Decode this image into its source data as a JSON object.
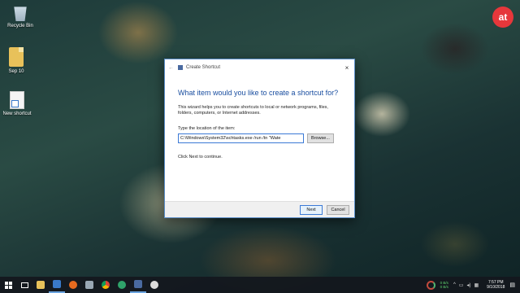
{
  "desktop": {
    "icons": [
      {
        "label": "Recycle Bin",
        "icon": "recycle-bin-icon"
      },
      {
        "label": "Sep 10",
        "icon": "folder-icon"
      },
      {
        "label": "New shortcut",
        "icon": "shortcut-icon"
      }
    ],
    "logo_text": "at"
  },
  "dialog": {
    "title": "Create Shortcut",
    "close_glyph": "×",
    "back_glyph": "←",
    "heading": "What item would you like to create a shortcut for?",
    "description": "This wizard helps you to create shortcuts to local or network programs, files, folders, computers, or Internet addresses.",
    "location_label": "Type the location of the item:",
    "location_value": "C:\\Windows\\System32\\schtasks.exe /run /tn \"Wate",
    "browse_label": "Browse...",
    "continue_text": "Click Next to continue.",
    "next_label": "Next",
    "cancel_label": "Cancel"
  },
  "taskbar": {
    "net_up": "0 B/s",
    "net_down": "0 B/s",
    "time": "7:57 PM",
    "date": "9/10/2018",
    "colors": {
      "accent": "#6aa3e0",
      "download": "#5fd46f"
    }
  }
}
